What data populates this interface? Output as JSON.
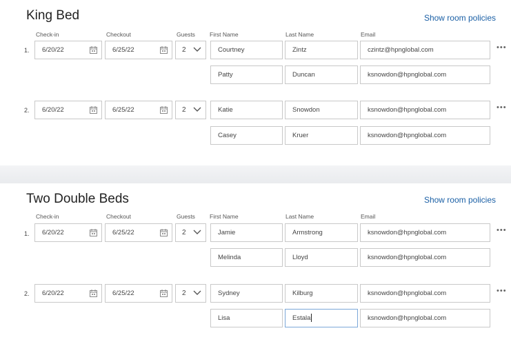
{
  "columns": {
    "checkin": "Check-in",
    "checkout": "Checkout",
    "guests": "Guests",
    "first_name": "First Name",
    "last_name": "Last Name",
    "email": "Email"
  },
  "policies_link": "Show room policies",
  "more_label": "•••",
  "sections": [
    {
      "title": "King Bed",
      "rooms": [
        {
          "num": "1.",
          "checkin": "6/20/22",
          "checkout": "6/25/22",
          "guests": "2",
          "people": [
            {
              "first": "Courtney",
              "last": "Zintz",
              "email": "czintz@hpnglobal.com"
            },
            {
              "first": "Patty",
              "last": "Duncan",
              "email": "ksnowdon@hpnglobal.com"
            }
          ]
        },
        {
          "num": "2.",
          "checkin": "6/20/22",
          "checkout": "6/25/22",
          "guests": "2",
          "people": [
            {
              "first": "Katie",
              "last": "Snowdon",
              "email": "ksnowdon@hpnglobal.com"
            },
            {
              "first": "Casey",
              "last": "Kruer",
              "email": "ksnowdon@hpnglobal.com"
            }
          ]
        }
      ]
    },
    {
      "title": "Two Double Beds",
      "rooms": [
        {
          "num": "1.",
          "checkin": "6/20/22",
          "checkout": "6/25/22",
          "guests": "2",
          "people": [
            {
              "first": "Jamie",
              "last": "Armstrong",
              "email": "ksnowdon@hpnglobal.com"
            },
            {
              "first": "Melinda",
              "last": "Lloyd",
              "email": "ksnowdon@hpnglobal.com"
            }
          ]
        },
        {
          "num": "2.",
          "checkin": "6/20/22",
          "checkout": "6/25/22",
          "guests": "2",
          "people": [
            {
              "first": "Sydney",
              "last": "Kilburg",
              "email": "ksnowdon@hpnglobal.com"
            },
            {
              "first": "Lisa",
              "last": "Estala",
              "email": "ksnowdon@hpnglobal.com"
            }
          ]
        }
      ]
    }
  ]
}
